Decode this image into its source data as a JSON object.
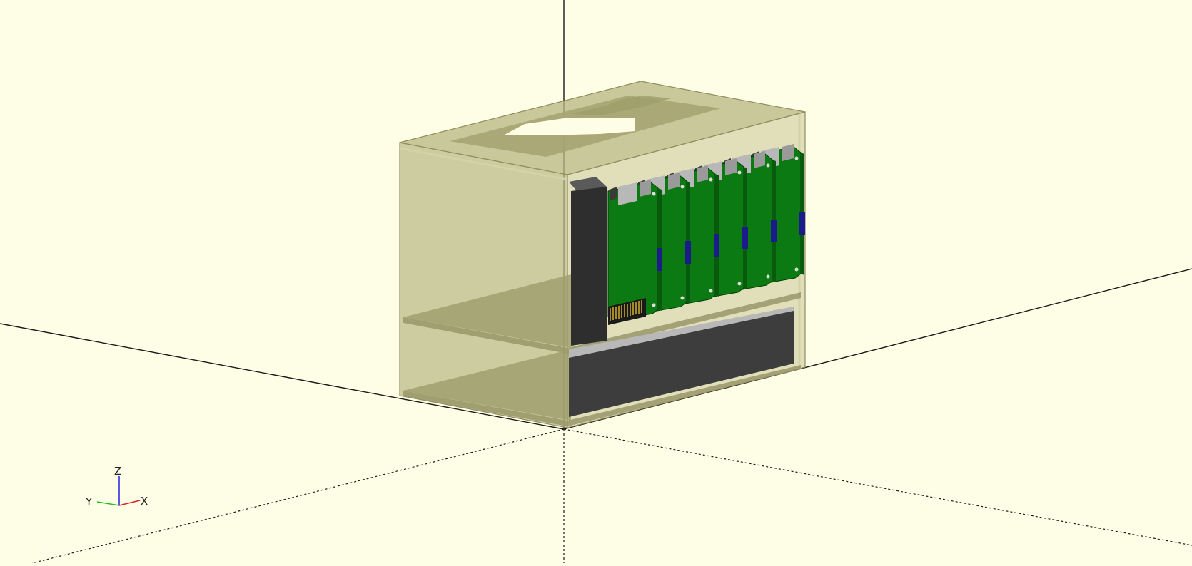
{
  "viewport": {
    "background": "#fefee6",
    "axis_color": "#1a1a1a"
  },
  "model": {
    "case_color": "#a9a874",
    "board_color": "#0b7a12",
    "board_count": 6,
    "drive_color": "#3d3d3d",
    "connector_color": "#b8b8b8",
    "sd_color": "#1b1b8c",
    "header_pins_color": "#c8a82a"
  },
  "axes_indicator": {
    "x_label": "X",
    "y_label": "Y",
    "z_label": "Z",
    "x_color": "#e02020",
    "y_color": "#20c020",
    "z_color": "#2020e0"
  }
}
